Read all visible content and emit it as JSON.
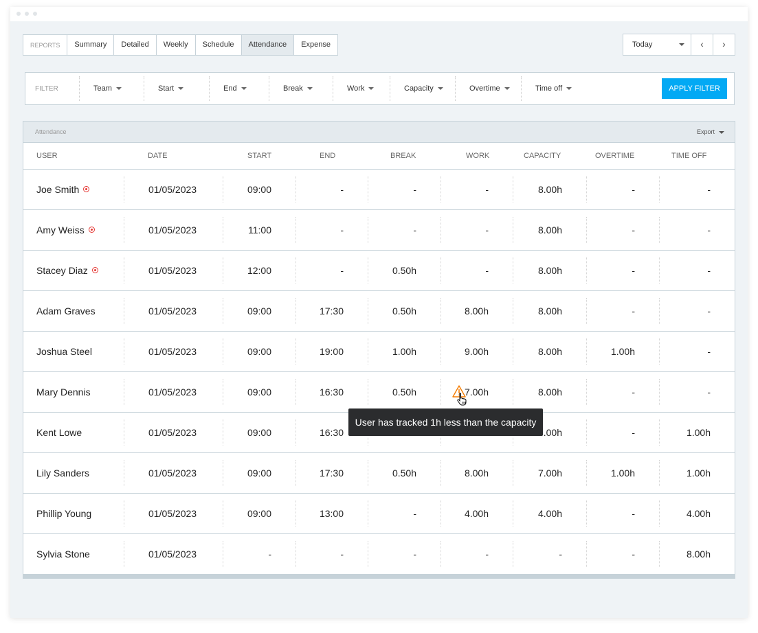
{
  "tabs": [
    {
      "label": "REPORTS"
    },
    {
      "label": "Summary"
    },
    {
      "label": "Detailed"
    },
    {
      "label": "Weekly"
    },
    {
      "label": "Schedule"
    },
    {
      "label": "Attendance",
      "active": true
    },
    {
      "label": "Expense"
    }
  ],
  "date_range": {
    "value": "Today",
    "prev_icon": "chevron-left",
    "next_icon": "chevron-right"
  },
  "filter": {
    "label": "FILTER",
    "items": [
      "Team",
      "Start",
      "End",
      "Break",
      "Work",
      "Capacity",
      "Overtime",
      "Time off"
    ],
    "apply_label": "APPLY FILTER",
    "accent": "#03a9f4"
  },
  "panel": {
    "title": "Attendance",
    "export_label": "Export"
  },
  "columns": [
    "USER",
    "DATE",
    "START",
    "END",
    "BREAK",
    "WORK",
    "CAPACITY",
    "OVERTIME",
    "TIME OFF"
  ],
  "rows": [
    {
      "user": "Joe Smith",
      "recording": true,
      "date": "01/05/2023",
      "start": "09:00",
      "end": "-",
      "break": "-",
      "work": "-",
      "capacity": "8.00h",
      "overtime": "-",
      "timeoff": "-"
    },
    {
      "user": "Amy Weiss",
      "recording": true,
      "date": "01/05/2023",
      "start": "11:00",
      "end": "-",
      "break": "-",
      "work": "-",
      "capacity": "8.00h",
      "overtime": "-",
      "timeoff": "-"
    },
    {
      "user": "Stacey Diaz",
      "recording": true,
      "date": "01/05/2023",
      "start": "12:00",
      "end": "-",
      "break": "0.50h",
      "work": "-",
      "capacity": "8.00h",
      "overtime": "-",
      "timeoff": "-"
    },
    {
      "user": "Adam Graves",
      "date": "01/05/2023",
      "start": "09:00",
      "end": "17:30",
      "break": "0.50h",
      "work": "8.00h",
      "capacity": "8.00h",
      "overtime": "-",
      "timeoff": "-"
    },
    {
      "user": "Joshua Steel",
      "date": "01/05/2023",
      "start": "09:00",
      "end": "19:00",
      "break": "1.00h",
      "work": "9.00h",
      "capacity": "8.00h",
      "overtime": "1.00h",
      "timeoff": "-"
    },
    {
      "user": "Mary Dennis",
      "warning": true,
      "date": "01/05/2023",
      "start": "09:00",
      "end": "16:30",
      "break": "0.50h",
      "work": "7.00h",
      "capacity": "8.00h",
      "overtime": "-",
      "timeoff": "-"
    },
    {
      "user": "Kent Lowe",
      "date": "01/05/2023",
      "start": "09:00",
      "end": "16:30",
      "break": "",
      "work": "",
      "capacity": ".00h",
      "overtime": "-",
      "timeoff": "1.00h"
    },
    {
      "user": "Lily Sanders",
      "date": "01/05/2023",
      "start": "09:00",
      "end": "17:30",
      "break": "0.50h",
      "work": "8.00h",
      "capacity": "7.00h",
      "overtime": "1.00h",
      "timeoff": "1.00h"
    },
    {
      "user": "Phillip Young",
      "date": "01/05/2023",
      "start": "09:00",
      "end": "13:00",
      "break": "-",
      "work": "4.00h",
      "capacity": "4.00h",
      "overtime": "-",
      "timeoff": "4.00h"
    },
    {
      "user": "Sylvia Stone",
      "date": "01/05/2023",
      "start": "-",
      "end": "-",
      "break": "-",
      "work": "-",
      "capacity": "-",
      "overtime": "-",
      "timeoff": "8.00h"
    }
  ],
  "tooltip": "User has tracked 1h less than the capacity",
  "colors": {
    "warning": "#f57c00",
    "recording": "#e53935"
  }
}
